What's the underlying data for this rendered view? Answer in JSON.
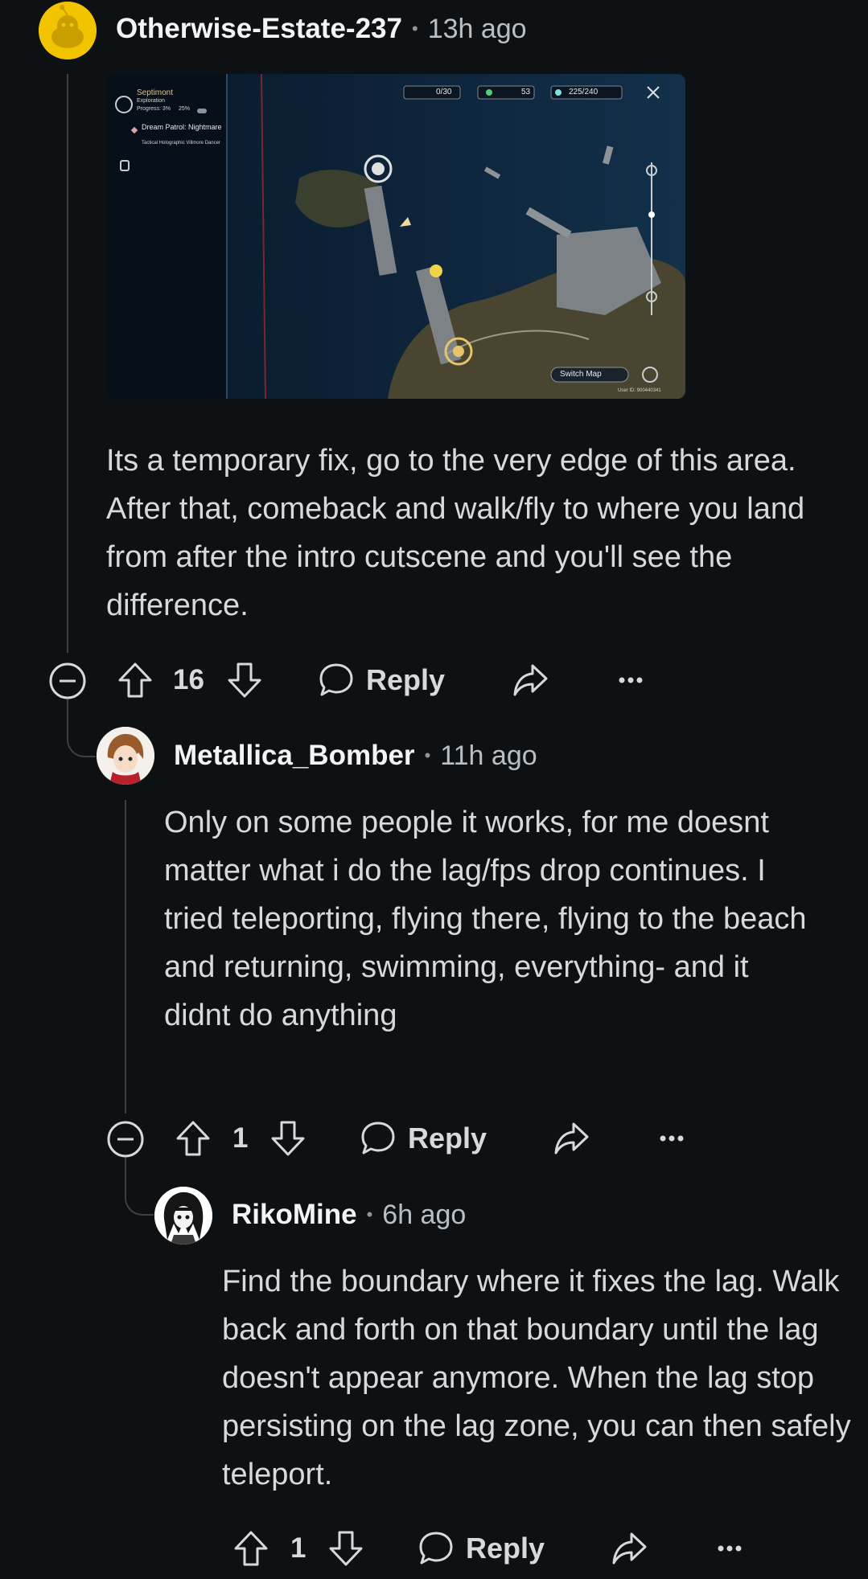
{
  "comments": [
    {
      "username": "Otherwise-Estate-237",
      "time": "13h ago",
      "body": "Its a temporary fix, go to the very edge of this area. After that, comeback and walk/fly to where you land from after the intro cutscene and you'll see the difference.",
      "votes": "16",
      "reply_label": "Reply",
      "image": {
        "region_name": "Septimont",
        "exploration_label": "Exploration",
        "progress_label": "Progress: 3%",
        "progress_pct": "25%",
        "quest_1": "Dream Patrol: Nightmare",
        "quest_2": "Tactical Holographic Villmore Dancer",
        "counter_1": "0/30",
        "counter_2": "53",
        "counter_3": "225/240",
        "switch_map": "Switch Map",
        "user_id": "User ID: 900440341"
      }
    },
    {
      "username": "Metallica_Bomber",
      "time": "11h ago",
      "body": "Only on some people it works, for me doesnt matter what i do the lag/fps drop continues. I tried teleporting, flying there, flying to the beach and returning, swimming, everything- and it didnt do anything",
      "votes": "1",
      "reply_label": "Reply"
    },
    {
      "username": "RikoMine",
      "time": "6h ago",
      "body": "Find the boundary where it fixes the lag. Walk back and forth on that boundary until the lag doesn't appear anymore. When the lag stop persisting on the lag zone, you can then safely teleport.",
      "votes": "1",
      "reply_label": "Reply"
    }
  ],
  "colors": {
    "background": "#0e1113",
    "thread_line": "#3a4045",
    "text": "#d7dadc",
    "avatar_yellow": "#f2c400"
  },
  "icons": [
    "collapse-icon",
    "upvote-icon",
    "downvote-icon",
    "comment-icon",
    "share-icon",
    "more-icon"
  ]
}
